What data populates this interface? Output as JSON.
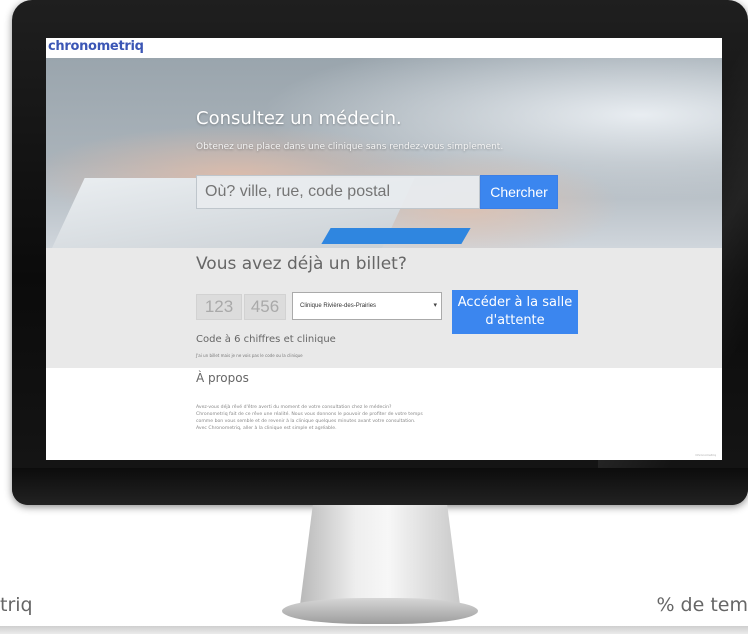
{
  "brand": {
    "logo_text": "chronometriq",
    "accent": "#3b86ef"
  },
  "hero": {
    "title": "Consultez un médecin.",
    "subtitle": "Obtenez une place dans une clinique sans rendez-vous simplement.",
    "search": {
      "placeholder": "Où? ville, rue, code postal",
      "value": ""
    },
    "search_button": "Chercher"
  },
  "ticket": {
    "title": "Vous avez déjà un billet?",
    "code_part1": "123",
    "code_part2": "456",
    "clinic_selected": "Clinique Rivière-des-Prairies",
    "access_button": "Accéder à la salle d'attente",
    "code_hint": "Code à 6 chiffres et clinique",
    "help_link": "J'ai un billet mais je ne vois pas le code ou la clinique"
  },
  "about": {
    "title": "À propos",
    "paragraphs": [
      "Avez-vous déjà rêvé d'être averti du moment de votre consultation chez le médecin?",
      "Chronometriq fait de ce rêve une réalité. Nous vous donnons le pouvoir de profiter de votre temps",
      "comme bon vous semble et de revenir à la clinique quelques minutes avant votre consultation.",
      "Avec Chronometriq, aller à la clinique est simple et agréable."
    ]
  },
  "footer": {
    "credit": "Chronometriq"
  },
  "captions": {
    "left": "triq",
    "right": "% de tem"
  }
}
